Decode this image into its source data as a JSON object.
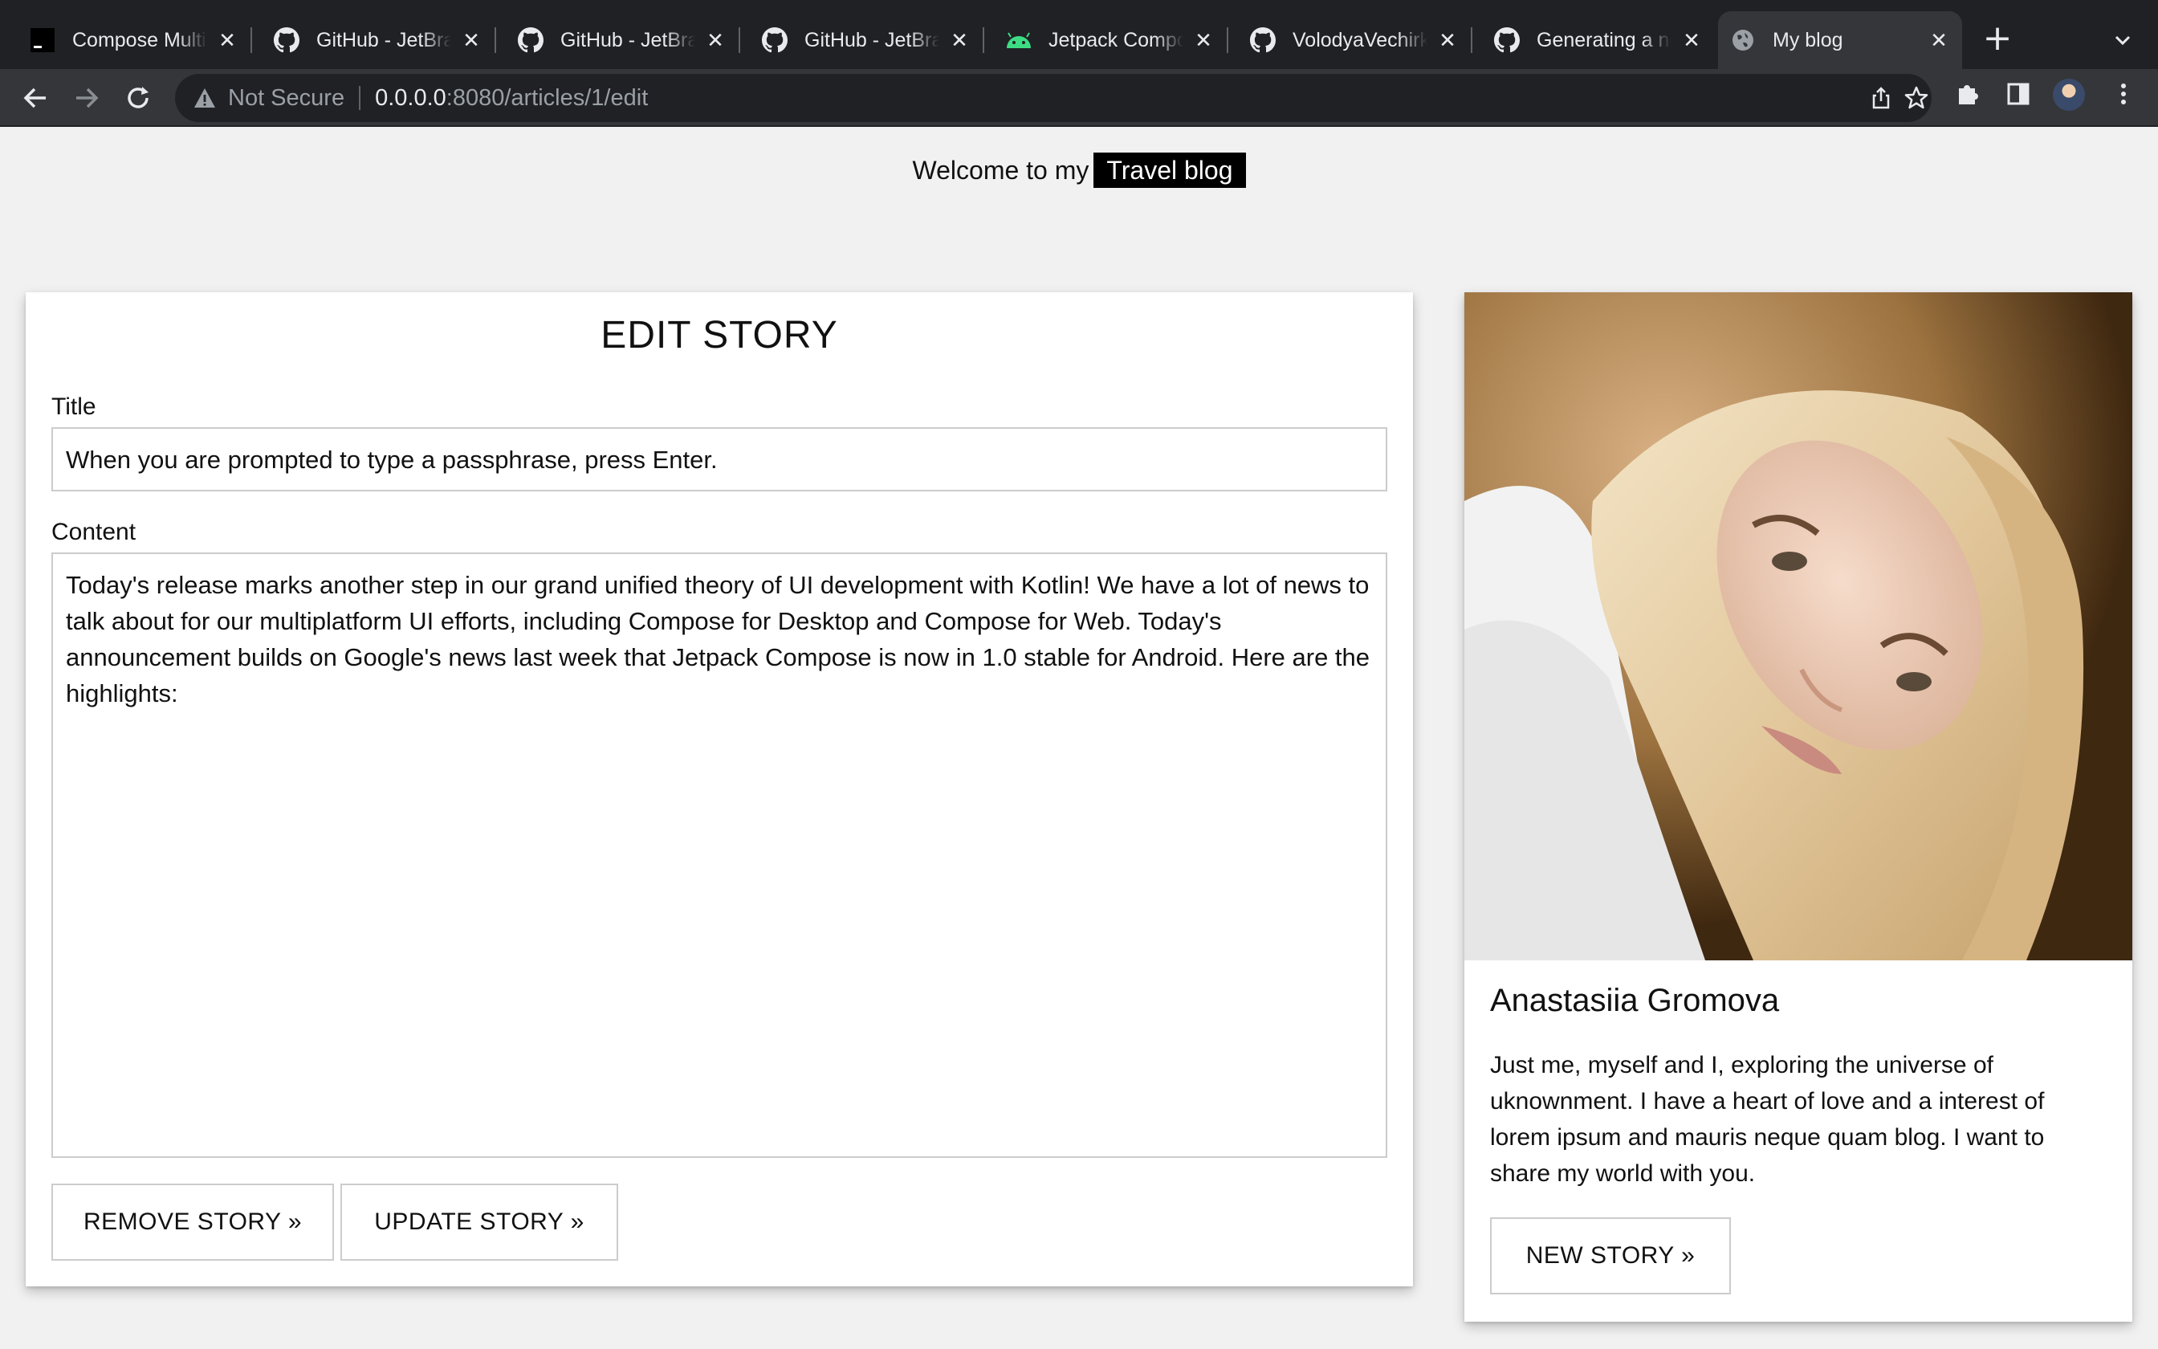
{
  "browser": {
    "tabs": [
      {
        "title": "Compose Multi",
        "icon": "terminal-icon"
      },
      {
        "title": "GitHub - JetBra",
        "icon": "github-icon"
      },
      {
        "title": "GitHub - JetBra",
        "icon": "github-icon"
      },
      {
        "title": "GitHub - JetBra",
        "icon": "github-icon"
      },
      {
        "title": "Jetpack Compo",
        "icon": "android-icon"
      },
      {
        "title": "VolodyaVechirk",
        "icon": "github-icon"
      },
      {
        "title": "Generating a ne",
        "icon": "github-icon"
      },
      {
        "title": "My blog",
        "icon": "globe-icon",
        "active": true
      }
    ],
    "security_label": "Not Secure",
    "url_host": "0.0.0.0",
    "url_path": ":8080/articles/1/edit"
  },
  "header": {
    "welcome_text": "Welcome to my",
    "brand": "Travel blog"
  },
  "edit_form": {
    "heading": "EDIT STORY",
    "title_label": "Title",
    "title_value": "When you are prompted to type a passphrase, press Enter.",
    "content_label": "Content",
    "content_value": "Today's release marks another step in our grand unified theory of UI development with Kotlin! We have a lot of news to talk about for our multiplatform UI efforts, including Compose for Desktop and Compose for Web. Today's announcement builds on Google's news last week that Jetpack Compose is now in 1.0 stable for Android. Here are the highlights:",
    "remove_button": "REMOVE STORY »",
    "update_button": "UPDATE STORY »"
  },
  "sidebar": {
    "author_name": "Anastasiia Gromova",
    "bio": "Just me, myself and I, exploring the universe of uknownment. I have a heart of love and a interest of lorem ipsum and mauris neque quam blog. I want to share my world with you.",
    "new_story_button": "NEW STORY »"
  },
  "colors": {
    "page_bg": "#f1f1f1",
    "brand_bg": "#000000",
    "chrome_dark": "#202124",
    "chrome_toolbar": "#35363a"
  }
}
